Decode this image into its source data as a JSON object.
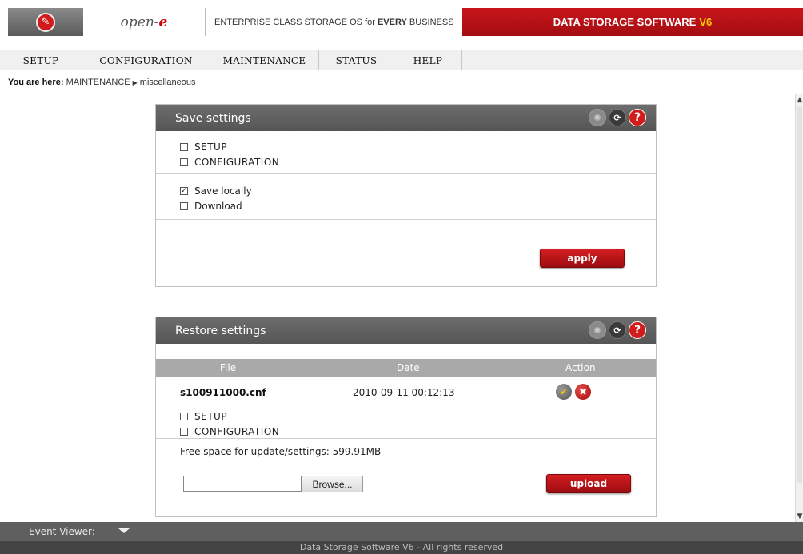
{
  "header": {
    "brand_name": "open-",
    "brand_e": "e",
    "tagline_prefix": "ENTERPRISE CLASS STORAGE OS for ",
    "tagline_bold": "EVERY",
    "tagline_suffix": " BUSINESS",
    "product_name": "DATA STORAGE SOFTWARE",
    "product_version": "V6",
    "logo_icon": "wrench-icon"
  },
  "menu": {
    "items": [
      {
        "label": "SETUP"
      },
      {
        "label": "CONFIGURATION"
      },
      {
        "label": "MAINTENANCE"
      },
      {
        "label": "STATUS"
      },
      {
        "label": "HELP"
      }
    ]
  },
  "breadcrumb": {
    "prefix": "You are here:",
    "path1": "MAINTENANCE",
    "path2": "miscellaneous"
  },
  "save_panel": {
    "title": "Save settings",
    "options_group1": [
      {
        "label": "SETUP",
        "checked": false
      },
      {
        "label": "CONFIGURATION",
        "checked": false
      }
    ],
    "options_group2": [
      {
        "label": "Save locally",
        "checked": true
      },
      {
        "label": "Download",
        "checked": false
      }
    ],
    "apply_label": "apply"
  },
  "restore_panel": {
    "title": "Restore settings",
    "columns": {
      "file": "File",
      "date": "Date",
      "action": "Action"
    },
    "row": {
      "file": "s100911000.cnf",
      "date": "2010-09-11 00:12:13",
      "options": [
        {
          "label": "SETUP",
          "checked": false
        },
        {
          "label": "CONFIGURATION",
          "checked": false
        }
      ]
    },
    "free_space": "Free space for update/settings: 599.91MB",
    "browse_label": "Browse...",
    "file_input_value": "",
    "upload_label": "upload"
  },
  "footer": {
    "event_viewer": "Event Viewer:",
    "copyright": "Data Storage Software V6 - All rights reserved"
  },
  "colors": {
    "accent_red": "#c8151b",
    "panel_header": "#5f5f5f",
    "table_header": "#a9a9a9"
  }
}
